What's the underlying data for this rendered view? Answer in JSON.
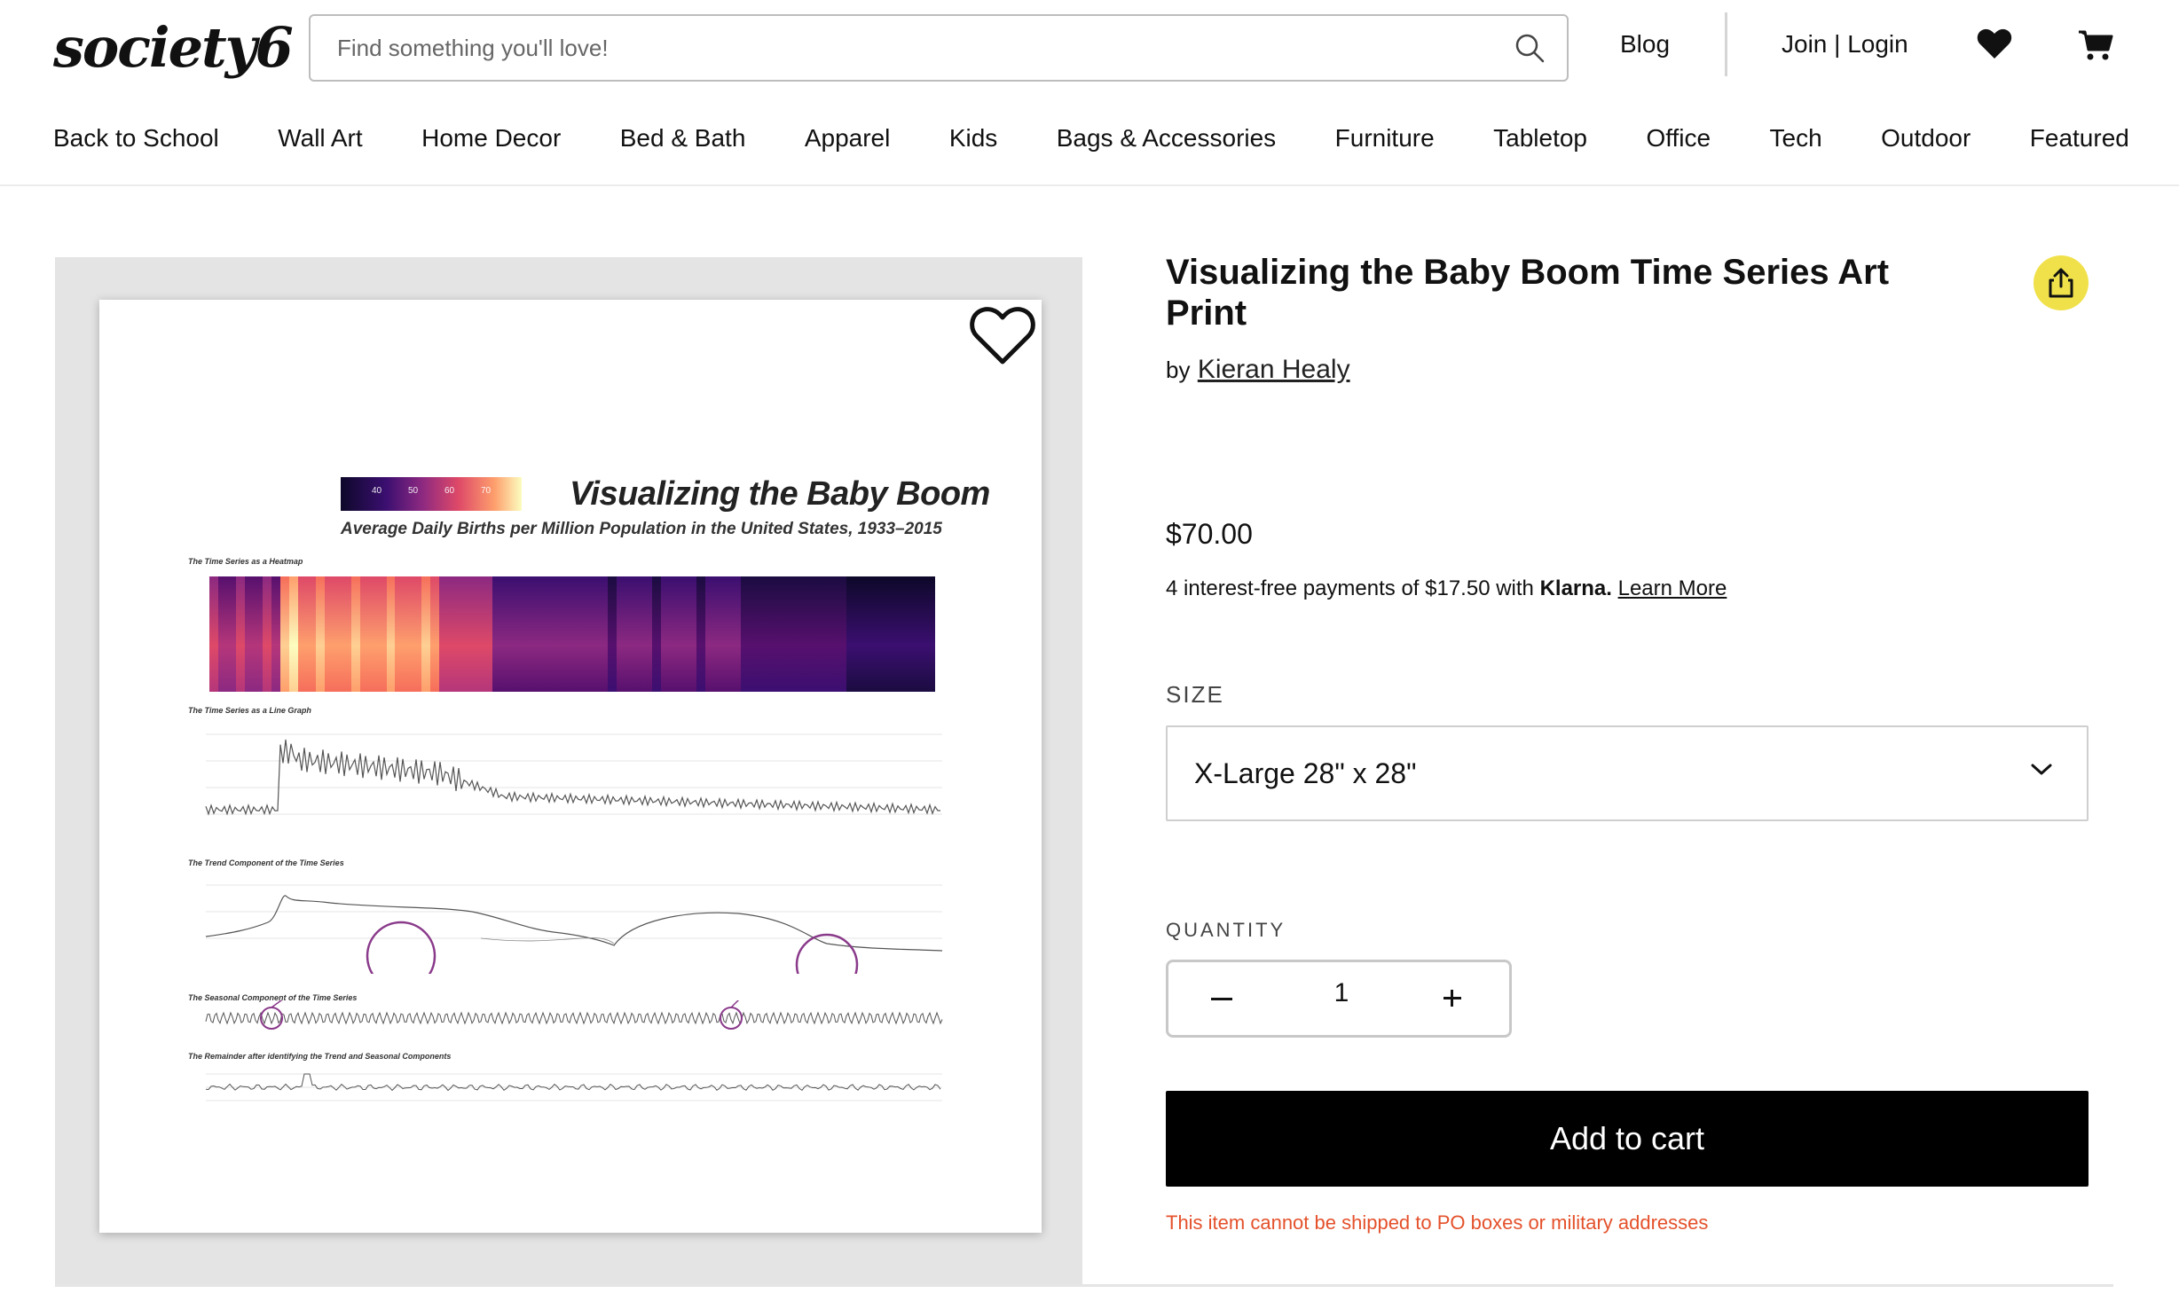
{
  "header": {
    "logo": "society6",
    "search_placeholder": "Find something you'll love!",
    "blog": "Blog",
    "account": "Join | Login"
  },
  "nav": {
    "items": [
      "Back to School",
      "Wall Art",
      "Home Decor",
      "Bed & Bath",
      "Apparel",
      "Kids",
      "Bags & Accessories",
      "Furniture",
      "Tabletop",
      "Office",
      "Tech",
      "Outdoor",
      "Featured"
    ]
  },
  "artwork": {
    "title": "Visualizing the Baby Boom",
    "subtitle": "Average Daily Births per Million Population in the United States, 1933–2015",
    "legend_ticks": [
      "40",
      "50",
      "60",
      "70"
    ],
    "sections": [
      "The Time Series as a Heatmap",
      "The Time Series as a Line Graph",
      "The Trend Component of the Time Series",
      "The Seasonal Component of the Time Series",
      "The Remainder after identifying the Trend and Seasonal Components"
    ]
  },
  "product": {
    "title": "Visualizing the Baby Boom Time Series Art Print",
    "by": "by",
    "artist": "Kieran Healy",
    "price": "$70.00",
    "klarna_text": "4 interest-free payments of $17.50 with",
    "klarna_brand": "Klarna.",
    "klarna_link": "Learn More",
    "size_label": "SIZE",
    "size_value": "X-Large 28\" x 28\"",
    "quantity_label": "QUANTITY",
    "quantity": "1",
    "add_to_cart": "Add to cart",
    "shipping_note": "This item cannot be shipped to PO boxes or military addresses"
  },
  "colors": {
    "share_button": "#f0e14a",
    "cart_button": "#000000",
    "warning_text": "#e4512b"
  }
}
